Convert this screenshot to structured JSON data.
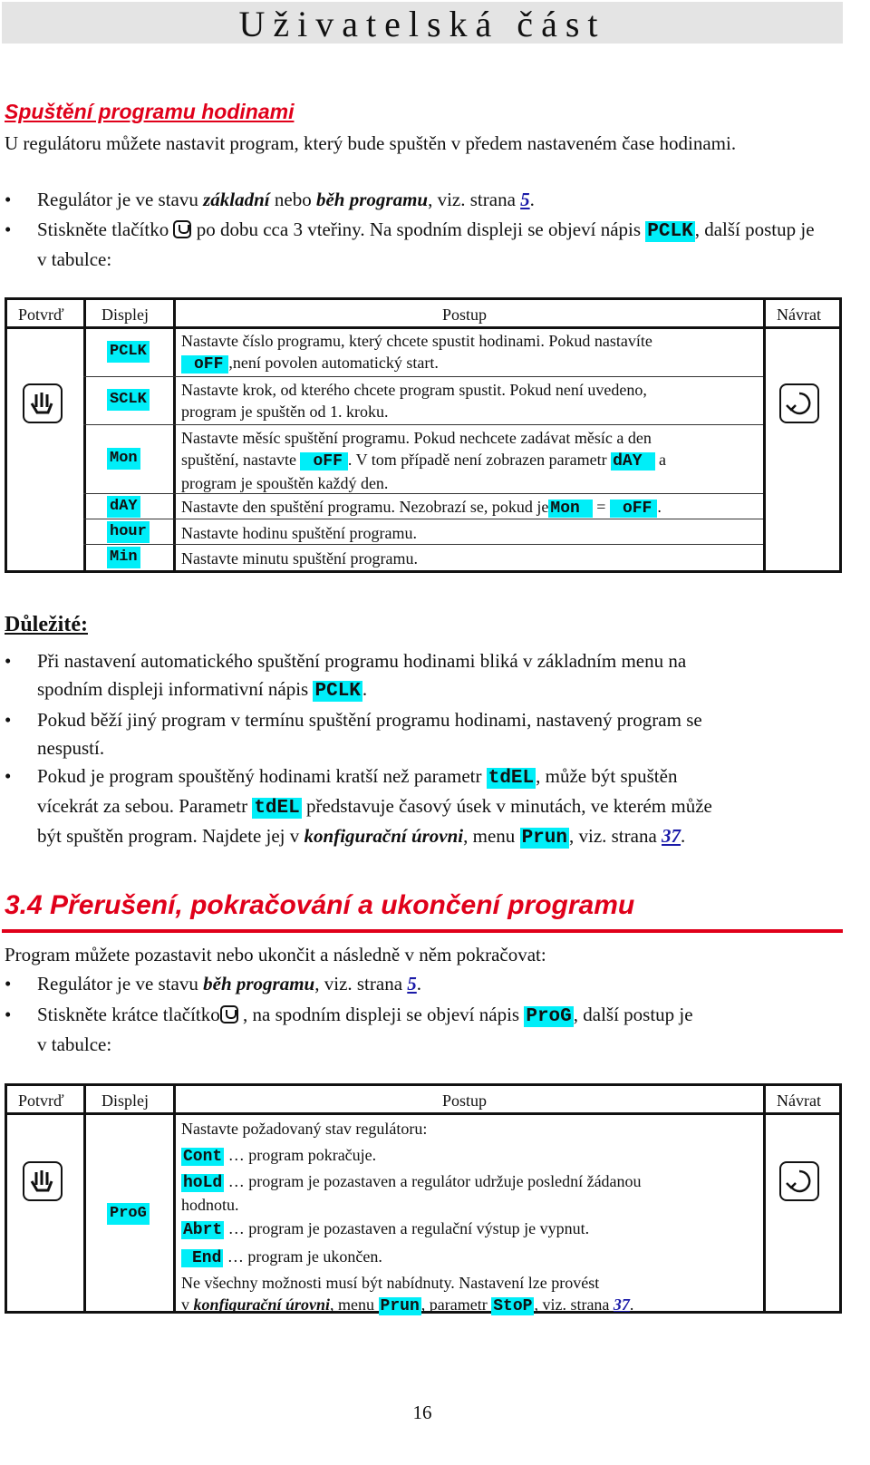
{
  "header": {
    "title": "Uživatelská část"
  },
  "section1": {
    "heading": "Spuštění programu hodinami",
    "intro": "U regulátoru můžete nastavit program, který bude spuštěn v předem nastaveném čase hodinami.",
    "bullets": [
      {
        "pre": "Regulátor je ve stavu ",
        "em1": "základní",
        "mid": " nebo ",
        "em2": "běh programu",
        "post": ", viz. strana ",
        "link": "5",
        "end": "."
      },
      {
        "pre": "Stiskněte tlačítko ",
        "icon": "hand-button-icon",
        "mid": " po dobu cca 3 vteřiny. Na spodním displeji se objeví nápis ",
        "code": "PCLK",
        "post": ", další postup je v tabulce:"
      }
    ]
  },
  "table1": {
    "headers": [
      "Potvrď",
      "Displej",
      "Postup",
      "Návrat"
    ],
    "confirm_icon": "hand-button-icon",
    "return_icon": "return-arrow-icon",
    "rows": [
      {
        "display": "PCLK",
        "text_a": "Nastavte číslo programu, který chcete spustit hodinami. Pokud nastavíte",
        "code": "oFF",
        "text_b": ",není povolen automatický start."
      },
      {
        "display": "SCLK",
        "text_a": "Nastavte krok, od kterého chcete program spustit. Pokud není uvedeno,",
        "text_b": "program je spuštěn od 1. kroku."
      },
      {
        "display": "Mon",
        "text_a": "Nastavte měsíc spuštění programu. Pokud nechcete zadávat měsíc a den",
        "text_b1": "spuštění, nastavte",
        "code1": "oFF",
        "text_b2": ". V tom případě není zobrazen parametr",
        "code2": "dAY",
        "text_b3": "a",
        "text_c": "program je spouštěn každý den."
      },
      {
        "display": "dAY",
        "text_a": "Nastavte den spuštění programu. Nezobrazí se, pokud je",
        "code1": "Mon",
        "eq": "=",
        "code2": "oFF",
        "end": "."
      },
      {
        "display": "hour",
        "text_a": "Nastavte hodinu spuštění programu."
      },
      {
        "display": "Min",
        "text_a": "Nastavte minutu spuštění programu."
      }
    ]
  },
  "important": {
    "heading": "Důležité:",
    "bullets": [
      {
        "a": "Při nastavení automatického spuštění programu hodinami bliká v základním menu na",
        "b": "spodním displeji informativní nápis ",
        "code": "PCLK",
        "end": "."
      },
      {
        "a": "Pokud běží jiný program v termínu spuštění programu hodinami, nastavený program se",
        "b": "nespustí."
      },
      {
        "a1": "Pokud je program spouštěný hodinami kratší než parametr ",
        "code1": "tdEL",
        "a2": ", může být spuštěn",
        "b1": "vícekrát za sebou. Parametr ",
        "code2": "tdEL",
        "b2": " představuje časový úsek v minutách, ve kterém může",
        "c1": "být spuštěn program. Najdete jej v ",
        "em": "konfigurační úrovni",
        "c2": ", menu ",
        "code3": "Prun",
        "c3": ", viz. strana ",
        "link": "37",
        "end": "."
      }
    ]
  },
  "section2": {
    "heading": "3.4 Přerušení, pokračování a ukončení programu",
    "intro": "Program můžete pozastavit nebo ukončit a následně v něm pokračovat:",
    "bullets": [
      {
        "pre": "Regulátor je ve stavu ",
        "em": "běh programu",
        "post": ", viz. strana ",
        "link": "5",
        "end": "."
      },
      {
        "pre": "Stiskněte krátce tlačítko",
        "icon": "hand-button-icon",
        "mid": " , na spodním displeji se objeví nápis ",
        "code": "ProG",
        "post": ", další postup je",
        "line2": "v tabulce:"
      }
    ]
  },
  "table2": {
    "headers": [
      "Potvrď",
      "Displej",
      "Postup",
      "Návrat"
    ],
    "display": "ProG",
    "lines": [
      {
        "text": "Nastavte požadovaný stav regulátoru:"
      },
      {
        "code": "Cont",
        "text": " … program pokračuje."
      },
      {
        "code": "hoLd",
        "text": " … program je pozastaven a regulátor udržuje poslední žádanou"
      },
      {
        "text": "hodnotu."
      },
      {
        "code": "Abrt",
        "text": " … program je pozastaven a regulační výstup je vypnut."
      },
      {
        "code": "End",
        "text": " … program je ukončen."
      },
      {
        "text": "Ne všechny možnosti musí být nabídnuty. Nastavení lze provést"
      },
      {
        "pre": "v ",
        "em": "konfigurační úrovni",
        "mid": ", menu ",
        "code1": "Prun",
        "mid2": ", parametr ",
        "code2": "StoP",
        "post": ", viz. strana ",
        "link": "37",
        "end": "."
      }
    ]
  },
  "footer": {
    "page_number": "16"
  },
  "colors": {
    "heading_red": "#e0001a",
    "code_highlight": "#00eef8",
    "link_blue": "#1a1aa8",
    "header_bg": "#e4e4e4"
  }
}
